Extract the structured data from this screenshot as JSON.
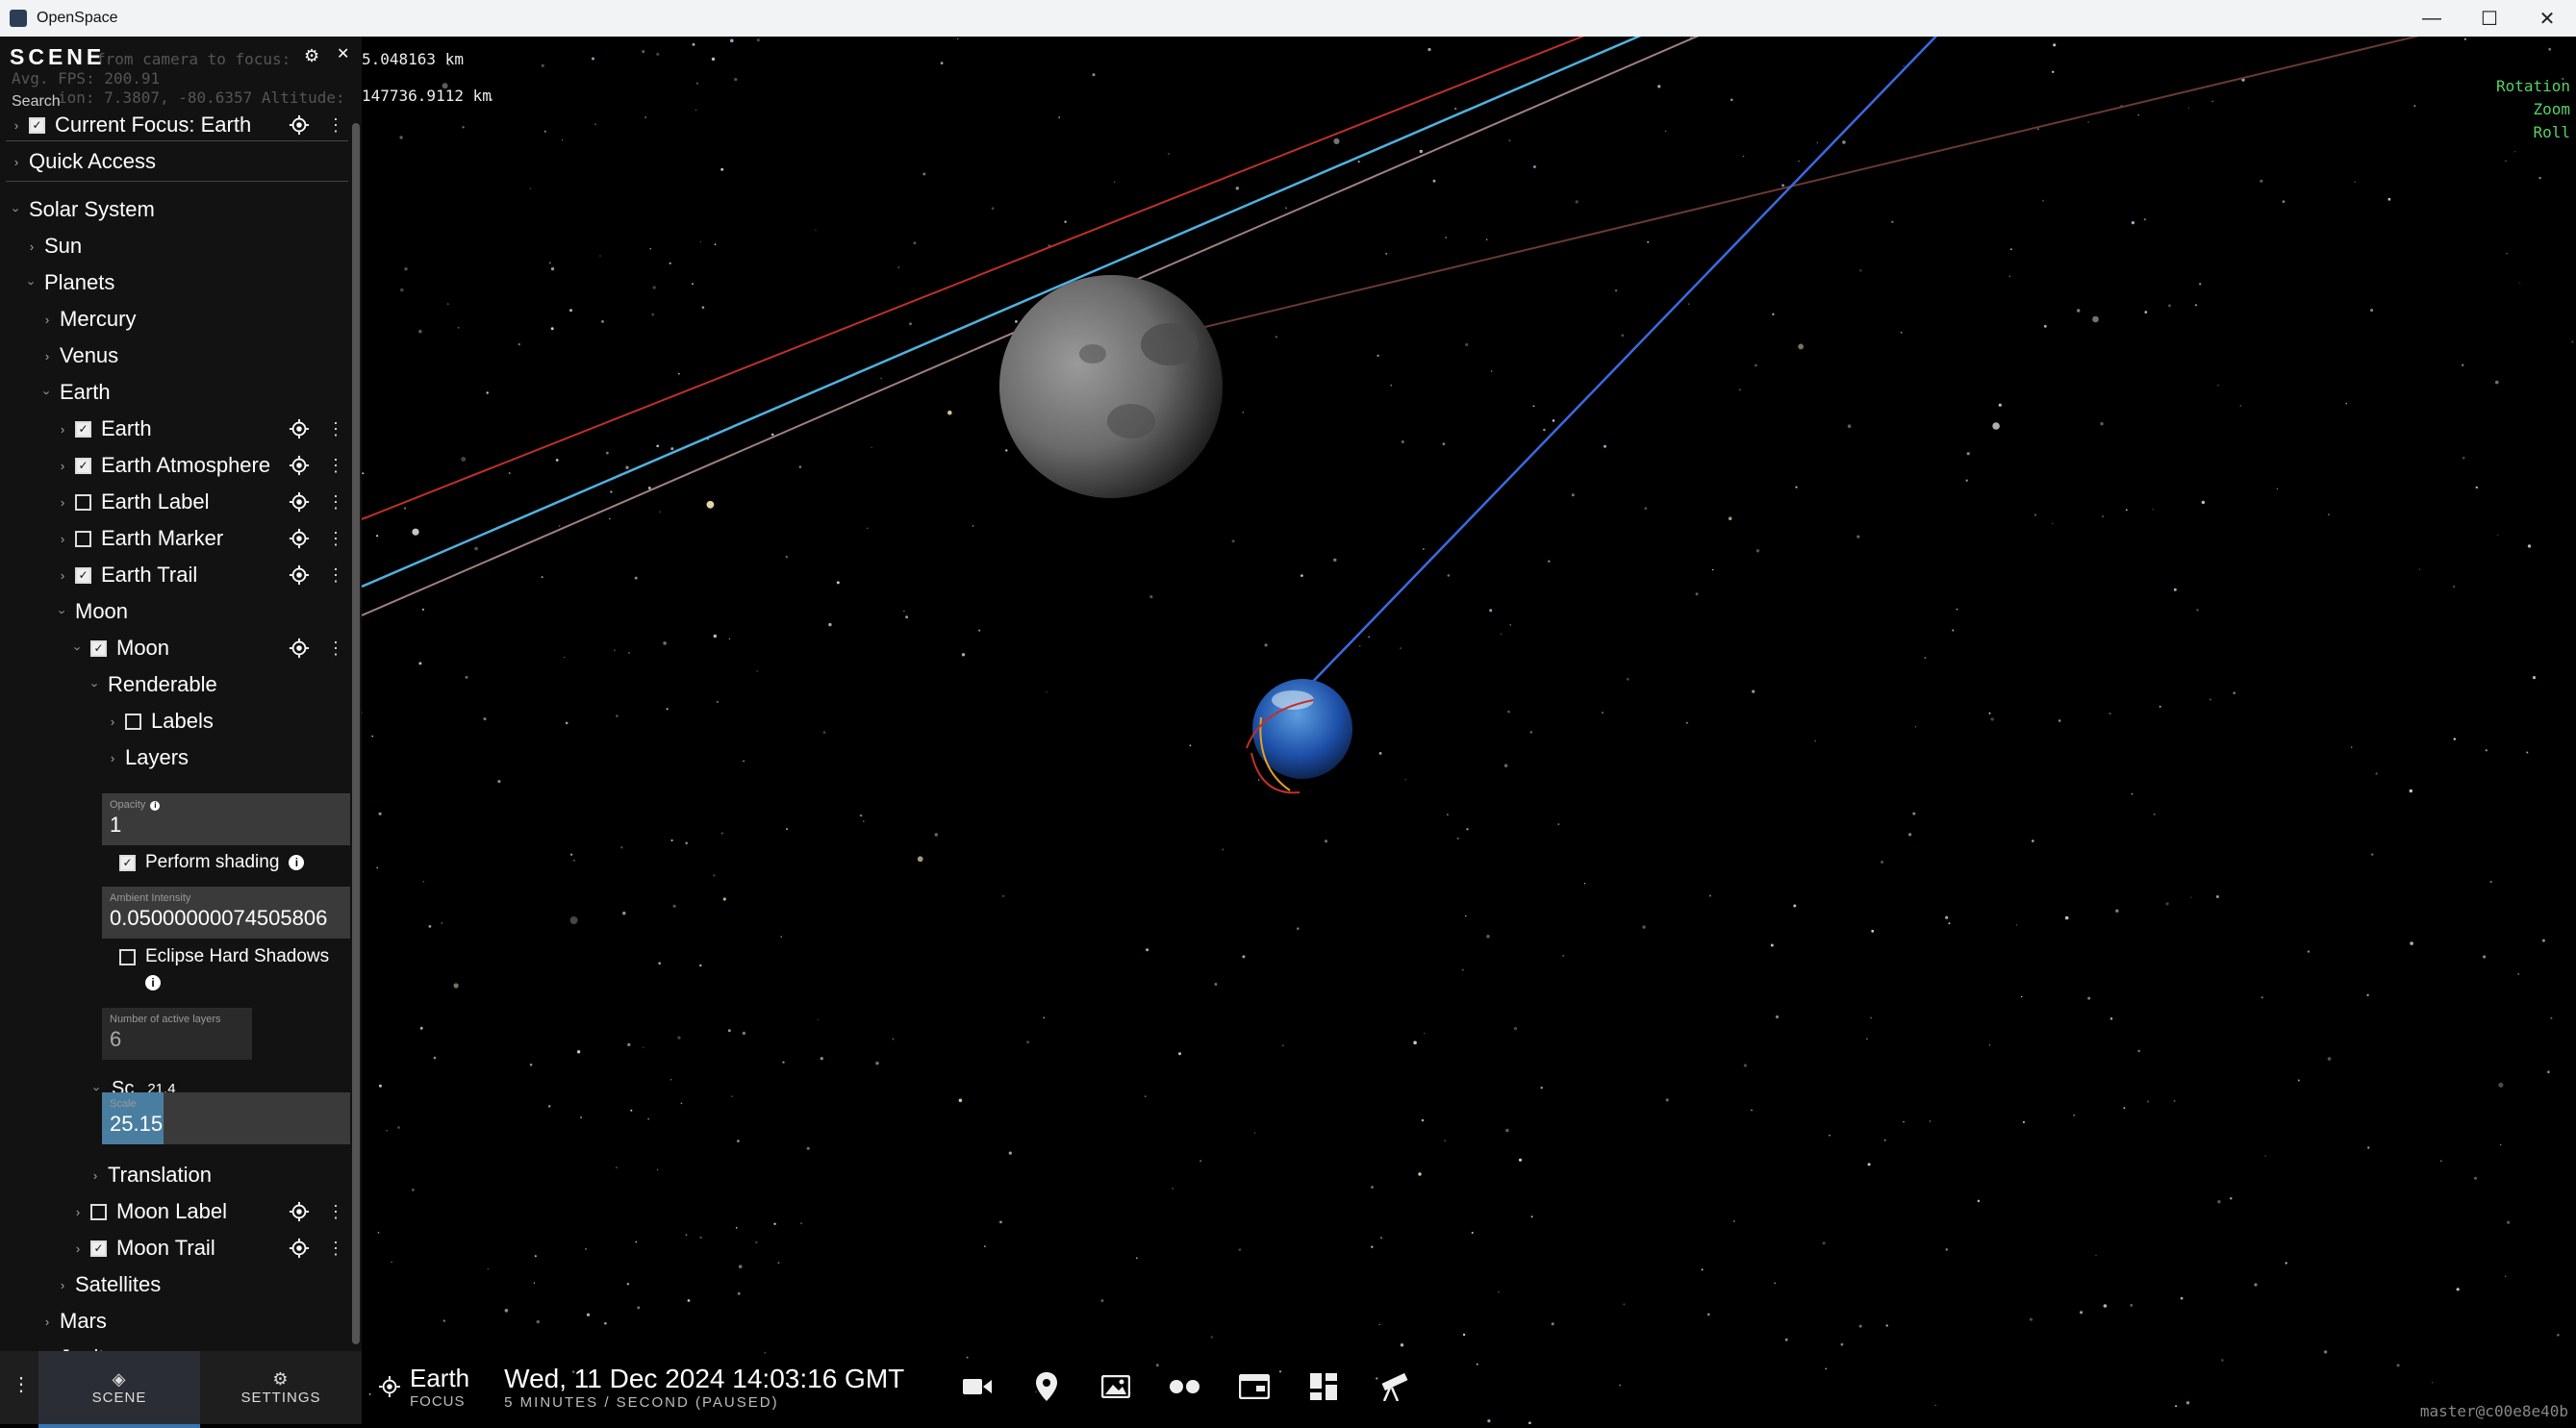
{
  "window": {
    "title": "OpenSpace",
    "minimize": "—",
    "maximize": "☐",
    "close": "✕"
  },
  "hud": {
    "distance_line": "5.048163 km",
    "altitude_line": "147736.9112 km",
    "ghost_lines": [
      "from camera to focus:",
      "Avg. FPS: 200.91",
      "ion: 7.3807, -80.6357  Altitude:"
    ],
    "nav_modes": [
      "Rotation",
      "Zoom",
      "Roll"
    ],
    "version": "master@c00e8e40b"
  },
  "sidebar": {
    "title": "SCENE",
    "search_placeholder": "Search",
    "tooltip_value": "21.4",
    "rows": [
      {
        "label": "Current Focus: Earth",
        "level": 0,
        "chev": "right",
        "checkbox": true,
        "checked": true,
        "actions": true
      },
      {
        "label": "Quick Access",
        "level": 0,
        "chev": "right"
      },
      {
        "label": "Solar System",
        "level": 0,
        "chev": "down"
      },
      {
        "label": "Sun",
        "level": 1,
        "chev": "right"
      },
      {
        "label": "Planets",
        "level": 1,
        "chev": "down"
      },
      {
        "label": "Mercury",
        "level": 2,
        "chev": "right"
      },
      {
        "label": "Venus",
        "level": 2,
        "chev": "right"
      },
      {
        "label": "Earth",
        "level": 2,
        "chev": "down"
      },
      {
        "label": "Earth",
        "level": 3,
        "chev": "right",
        "checkbox": true,
        "checked": true,
        "actions": true
      },
      {
        "label": "Earth Atmosphere",
        "level": 3,
        "chev": "right",
        "checkbox": true,
        "checked": true,
        "actions": true
      },
      {
        "label": "Earth Label",
        "level": 3,
        "chev": "right",
        "checkbox": true,
        "checked": false,
        "actions": true
      },
      {
        "label": "Earth Marker",
        "level": 3,
        "chev": "right",
        "checkbox": true,
        "checked": false,
        "actions": true
      },
      {
        "label": "Earth Trail",
        "level": 3,
        "chev": "right",
        "checkbox": true,
        "checked": true,
        "actions": true
      },
      {
        "label": "Moon",
        "level": 3,
        "chev": "down"
      },
      {
        "label": "Moon",
        "level": 4,
        "chev": "down",
        "checkbox": true,
        "checked": true,
        "actions": true
      },
      {
        "label": "Renderable",
        "level": 5,
        "chev": "down"
      },
      {
        "label": "Labels",
        "level": 6,
        "chev": "right",
        "checkbox": true,
        "checked": false
      },
      {
        "label": "Layers",
        "level": 6,
        "chev": "right"
      }
    ],
    "props": {
      "opacity_label": "Opacity",
      "opacity_value": "1",
      "shading_label": "Perform shading",
      "ambient_label": "Ambient Intensity",
      "ambient_value": "0.05000000074505806",
      "eclipse_label": "Eclipse Hard Shadows",
      "layers_label": "Number of active layers",
      "layers_value": "6",
      "scale_group": "Sc",
      "scale_label": "Scale",
      "scale_value": "25.15"
    },
    "rows_after": [
      {
        "label": "Translation",
        "level": 5,
        "chev": "right"
      },
      {
        "label": "Moon Label",
        "level": 4,
        "chev": "right",
        "checkbox": true,
        "checked": false,
        "actions": true
      },
      {
        "label": "Moon Trail",
        "level": 4,
        "chev": "right",
        "checkbox": true,
        "checked": true,
        "actions": true
      },
      {
        "label": "Satellites",
        "level": 3,
        "chev": "right"
      },
      {
        "label": "Mars",
        "level": 2,
        "chev": "right"
      },
      {
        "label": "Jupiter",
        "level": 2,
        "chev": "right"
      }
    ],
    "tabs": [
      {
        "label": "SCENE"
      },
      {
        "label": "SETTINGS"
      }
    ]
  },
  "bottom": {
    "focus_label": "Earth",
    "focus_sub": "FOCUS",
    "time": "Wed, 11 Dec 2024 14:03:16 GMT",
    "time_sub": "5 MINUTES / SECOND (PAUSED)",
    "icons": [
      "camera-icon",
      "map-pin-icon",
      "image-icon",
      "flickr-icon",
      "browser-icon",
      "dashboard-icon",
      "telescope-icon"
    ]
  },
  "colors": {
    "accent": "#3a74b0",
    "nav_text": "#58d068",
    "trail_red": "#c0302a",
    "trail_cyan": "#4fb2e0",
    "trail_blue": "#3a6be0"
  }
}
